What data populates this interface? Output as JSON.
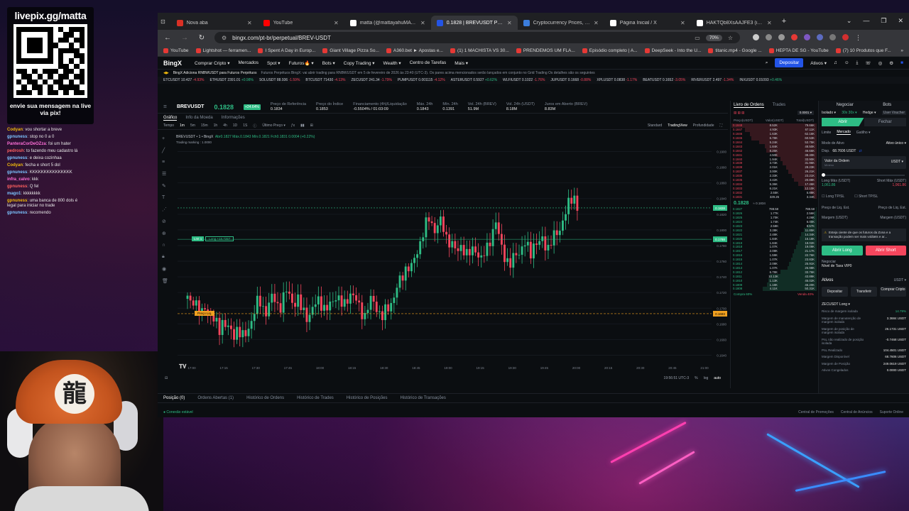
{
  "overlay": {
    "livepix_title": "livepix.gg/matta",
    "livepix_msg": "envie sua mensagem na live via pix!",
    "chat": [
      {
        "user": "Codyan",
        "msg": "vou shortar a breve"
      },
      {
        "user": "gpnuness",
        "msg": "stop no 0 a 0"
      },
      {
        "user": "PanteraCorDeOZza",
        "msg": "foi um hater"
      },
      {
        "user": "pedrosh",
        "msg": "to fazendo meu cadastro lá"
      },
      {
        "user": "gpnuness",
        "msg": "e deixa cozinhaa"
      },
      {
        "user": "Codyan",
        "msg": "fecha e short 5 dol"
      },
      {
        "user": "gpnuness",
        "msg": "KKKKKKKKKKKKKKK"
      },
      {
        "user": "infra_calvo",
        "msg": "kkk"
      },
      {
        "user": "gpnuness",
        "msg": "Q fel"
      },
      {
        "user": "mago1",
        "msg": "kkkkkkkk"
      },
      {
        "user": "gpnuness",
        "msg": "uma banca de 800 dols é legal para iniciar no trade"
      },
      {
        "user": "gpnuness",
        "msg": "recomendo"
      }
    ],
    "cap_symbol": "龍"
  },
  "browser": {
    "tabs": [
      {
        "label": "Nova aba",
        "color": "#d93025"
      },
      {
        "label": "YouTube",
        "color": "#ff0000"
      },
      {
        "label": "matta (@mattayahuMATEUS) / X",
        "color": "#ffffff"
      },
      {
        "label": "0.1828 | BREVUSDT Perpétuos ou",
        "color": "#2354e6"
      },
      {
        "label": "Cryptocurrency Prices, Charts A",
        "color": "#3b7ddd"
      },
      {
        "label": "Página Inicial / X",
        "color": "#ffffff"
      },
      {
        "label": "HAKTQb8XsAAJFE3 (imagem JPE",
        "color": "#ffffff"
      }
    ],
    "new_tab": "+",
    "win_controls": [
      "⌄",
      "—",
      "❐",
      "✕"
    ],
    "url": "bingx.com/pt-br/perpetual/BREV-USDT",
    "zoom": "70%",
    "bookmarks": [
      "YouTube",
      "Lightshot — ferramen...",
      "I Spent A Day in Europ...",
      "Giant Village Pizza So...",
      "A360.bet ► Apostas e...",
      "(1) 1 MACHISTA VS 30...",
      "PRENDEMOS UM FLA...",
      "Episódio completo | A...",
      "DeepSeek - Into the U...",
      "titanic.mp4 - Google ...",
      "HEPTA DE SG - YouTube",
      "(7) 10 Produtos que F..."
    ]
  },
  "bingx": {
    "logo": "BingX",
    "nav": [
      "Comprar Cripto ▾",
      "Mercados",
      "Spot ▾",
      "Futuros🔥 ▾",
      "Bots ▾",
      "Copy Trading ▾",
      "Wealth ▾",
      "Centro de Tarefas",
      "Mais ▾"
    ],
    "deposit": "Depositar",
    "assets": "Ativos ▾",
    "news": "BingX Adiciona RNBWUSDT para Futuros Perpétuos",
    "news_detail": "Futuros Perpétuos BingX: vai abrir trading para RNBWUSDT em 5 de fevereiro de 2026 às 23:40 (UTC-3). Os pares acima mencionados serão lançados em conjunto no Grid Trading Os detalhes são os seguintes",
    "tickers": [
      {
        "s": "ETCUSDT",
        "p": "10.427",
        "c": "-4.93%",
        "neg": true
      },
      {
        "s": "ETHUSDT",
        "p": "2391.01",
        "c": "+0.98%",
        "neg": false
      },
      {
        "s": "SOLUSDT",
        "p": "88.936",
        "c": "-1.59%",
        "neg": true
      },
      {
        "s": "BTCUSDT",
        "p": "71430",
        "c": "-4.13%",
        "neg": true
      },
      {
        "s": "ZECUSDT",
        "p": "241.34",
        "c": "-1.79%",
        "neg": true
      },
      {
        "s": "PUMPUSDT",
        "p": "0.001115",
        "c": "-4.12%",
        "neg": true
      },
      {
        "s": "ASTERUSDT",
        "p": "0.5927",
        "c": "+0.62%",
        "neg": false
      },
      {
        "s": "WLFIUSDT",
        "p": "0.1022",
        "c": "-1.76%",
        "neg": true
      },
      {
        "s": "JUPUSDT",
        "p": "0.1668",
        "c": "-0.88%",
        "neg": true
      },
      {
        "s": "XPLUSDT",
        "p": "0.0838",
        "c": "-1.17%",
        "neg": true
      },
      {
        "s": "BEATUSDT",
        "p": "0.1652",
        "c": "-3.05%",
        "neg": true
      },
      {
        "s": "RIVERUSDT",
        "p": "2.497",
        "c": "-1.34%",
        "neg": true
      },
      {
        "s": "INXUSDT",
        "p": "0.01093",
        "c": "+0.46%",
        "neg": false
      }
    ],
    "symbol": {
      "name": "BREVUSDT",
      "price": "0.1828",
      "change": "+24.64%",
      "stats": [
        {
          "k": "Preço de Referência",
          "v": "0.1834"
        },
        {
          "k": "Preço do Índice",
          "v": "0.1853"
        },
        {
          "k": "Financiamento (4h)/Liquidação",
          "v": "-0.5504% / 01:03:09"
        },
        {
          "k": "Máx. 24h",
          "v": "0.1843"
        },
        {
          "k": "Mín. 24h",
          "v": "0.1391"
        },
        {
          "k": "Vol. 24h (BREV)",
          "v": "51.9M"
        },
        {
          "k": "Vol. 24h (USDT)",
          "v": "8.18M"
        },
        {
          "k": "Juros em Aberto (BREV)",
          "v": "8.83M"
        }
      ]
    },
    "chart_tabs": [
      "Gráfico",
      "Info da Moeda",
      "Informações"
    ],
    "tv_toolbar": [
      "Tempo",
      "1m",
      "5m",
      "15m",
      "1h",
      "4h",
      "1D",
      "1S",
      "ⓘ",
      "Último Preço ▾"
    ],
    "tv_views": [
      "Standard",
      "TradingView",
      "Profundidade"
    ],
    "ohlc": {
      "label": "BREVUSDT • 1 • BingX",
      "text": "Abr0.1827 Máx.0.1843 Mín.0.1821 Fch0.1831 0.0004 (+0.22%)",
      "mark": "Trading marking : 1.0000"
    },
    "pos_label": [
      "Lmt 1",
      "Long +16.7257"
    ],
    "liq_label": "Preço Liq.",
    "footer_time": "19:56:51 UTC-3",
    "footer_r": [
      "%",
      "log",
      "auto"
    ],
    "bottom_tabs": [
      "Posição (0)",
      "Ordens Abertas (1)",
      "Histórico de Ordens",
      "Histórico de Trades",
      "Histórico de Posições",
      "Histórico de Transações"
    ],
    "status": "Conexão estável",
    "status_r": [
      "Central de Promoções",
      "Central de Anúncios",
      "Suporte Online"
    ],
    "orderbook": {
      "tabs": [
        "Livro de Ordens",
        "Trades"
      ],
      "step": "0.0001 ▾",
      "head": [
        "Preço(USDT)",
        "Valor(USDT)",
        "Total(USDT)"
      ],
      "asks": [
        [
          "0.1848",
          "8.52K",
          "79.66K"
        ],
        [
          "0.1847",
          "4.93K",
          "67.11K"
        ],
        [
          "0.1846",
          "1.63K",
          "62.16K"
        ],
        [
          "0.1845",
          "6.78K",
          "60.53K"
        ],
        [
          "0.1844",
          "5.24K",
          "53.75K"
        ],
        [
          "0.1843",
          "1.84K",
          "48.50K"
        ],
        [
          "0.1842",
          "8.26K",
          "46.66K"
        ],
        [
          "0.1841",
          "4.50K",
          "38.40K"
        ],
        [
          "0.1840",
          "1.94K",
          "33.90K"
        ],
        [
          "0.1839",
          "3.73K",
          "31.96K"
        ],
        [
          "0.1838",
          "2.01K",
          "28.23K"
        ],
        [
          "0.1837",
          "3.00K",
          "26.21K"
        ],
        [
          "0.1836",
          "2.33K",
          "23.21K"
        ],
        [
          "0.1835",
          "3.42K",
          "20.88K"
        ],
        [
          "0.1834",
          "5.36K",
          "17.46K"
        ],
        [
          "0.1833",
          "6.21K",
          "12.10K"
        ],
        [
          "0.1832",
          "2.55K",
          "5.89K"
        ],
        [
          "0.1831",
          "329.26",
          "3.34K"
        ]
      ],
      "mid_price": "0.1828",
      "mid_sub": "≈ 0.1834",
      "bids": [
        [
          "0.1827",
          "788.58",
          "788.58"
        ],
        [
          "0.1826",
          "1.77K",
          "2.56K"
        ],
        [
          "0.1825",
          "1.70K",
          "4.26K"
        ],
        [
          "0.1824",
          "1.74K",
          "6.00K"
        ],
        [
          "0.1823",
          "2.58K",
          "8.57K"
        ],
        [
          "0.1822",
          "3.28K",
          "11.85K"
        ],
        [
          "0.1821",
          "2.48K",
          "14.34K"
        ],
        [
          "0.1820",
          "1.84K",
          "16.18K"
        ],
        [
          "0.1819",
          "1.84K",
          "18.02K"
        ],
        [
          "0.1818",
          "1.07K",
          "19.09K"
        ],
        [
          "0.1817",
          "2.08K",
          "21.17K"
        ],
        [
          "0.1816",
          "1.59K",
          "22.76K"
        ],
        [
          "0.1815",
          "1.07K",
          "23.83K"
        ],
        [
          "0.1814",
          "2.08K",
          "25.91K"
        ],
        [
          "0.1813",
          "1.07K",
          "26.98K"
        ],
        [
          "0.1812",
          "6.78K",
          "33.76K"
        ],
        [
          "0.1811",
          "10.13K",
          "43.89K"
        ],
        [
          "0.1810",
          "1.13K",
          "45.02K"
        ],
        [
          "0.1809",
          "1.18K",
          "46.20K"
        ],
        [
          "0.1808",
          "4.11K",
          "50.31K"
        ]
      ],
      "ratio_buy": "Compra 60%",
      "ratio_sell": "Venda 40%"
    },
    "panel": {
      "tabs": [
        "Negociar",
        "Bots"
      ],
      "margin": "Isolado ▾",
      "leverage": "30x 30x ▾",
      "mode": "Hedge ▾",
      "user_mode": "User Voucher",
      "open": "Abrir",
      "close": "Fechar",
      "order_types": [
        "Limite",
        "Mercado",
        "Gatilho ▾"
      ],
      "asset_mode_label": "Modo de Ativo",
      "asset_mode_value": "Ativo único ▾",
      "avail_label": "Disp.",
      "avail_value": "68.7606 USDT",
      "order_value_label": "Valor da Ordem",
      "order_value_hint": "Mínimo",
      "order_value_unit": "USDT ▾",
      "long_max_label": "Long Máx (USDT)",
      "long_max_value": "1,061.86",
      "short_max_label": "Short Máx (USDT)",
      "short_max_value": "1,061.86",
      "tpsl_long": "Long TP/SL",
      "tpsl_short": "Short TP/SL",
      "liq_long_label": "Preço de Liq. Est.",
      "liq_short_label": "Preço de Liq. Est.",
      "margin_long_label": "Margem (USDT)",
      "margin_short_label": "Margem (USDT)",
      "warn": "Esteja ciente de que os futuros da Zona e a transação podem ser mais voláteis e ar...",
      "buy": "Abrir Long",
      "sell": "Abrir Short",
      "fee_label": "Negociar",
      "fee_value": "Nível de Taxa VIP0",
      "assets_title": "Ativos",
      "assets_unit": "USDT ▾",
      "asset_btns": [
        "Depositar",
        "Transferir",
        "Comprar Cripto"
      ],
      "position": "ZECUSDT Long ▾",
      "kv": [
        {
          "k": "Risco de margem isolada",
          "v": "14.79%"
        },
        {
          "k": "Margem de manutenção de margem isolada",
          "v": "3.3684 USDT"
        },
        {
          "k": "Margem de posição de margem isolada",
          "v": "26.1731 USDT"
        },
        {
          "k": "PnL não realizado de posição isolada",
          "v": "-0.7468 USDT"
        },
        {
          "k": "PnL Realizado",
          "v": "104.4501 USDT"
        },
        {
          "k": "Margem Disponível",
          "v": "68.7606 USDT"
        },
        {
          "k": "Margem de Posição",
          "v": "249.0619 USDT"
        },
        {
          "k": "Ativos Congelados",
          "v": "0.0000 USDT"
        }
      ]
    },
    "y_axis_prices": [
      "0.1900",
      "0.1880",
      "0.1860",
      "0.1840",
      "0.1820",
      "0.1800",
      "0.1780",
      "0.1760",
      "0.1740",
      "0.1720",
      "0.1700",
      "0.1680",
      "0.1660",
      "0.1640"
    ],
    "x_axis_times": [
      "17:00",
      "17:15",
      "17:30",
      "17:45",
      "18:00",
      "18:15",
      "18:30",
      "18:45",
      "19:00",
      "19:15",
      "19:30",
      "19:45",
      "20:00",
      "20:15",
      "20:30",
      "20:45",
      "21:00"
    ],
    "current_price_tag": "0.1828",
    "pos_price_tag": "0.1788",
    "liq_price_tag": "0.1693"
  },
  "chart_data": {
    "type": "candlestick",
    "ylim": [
      0.1635,
      0.1905
    ],
    "close": [
      0.1712,
      0.1705,
      0.1715,
      0.1698,
      0.169,
      0.1702,
      0.1695,
      0.1688,
      0.168,
      0.1672,
      0.1686,
      0.1678,
      0.167,
      0.1664,
      0.1675,
      0.1668,
      0.166,
      0.1672,
      0.1685,
      0.1698,
      0.171,
      0.1703,
      0.1695,
      0.1705,
      0.1715,
      0.1708,
      0.17,
      0.1712,
      0.1722,
      0.1715,
      0.1705,
      0.1712,
      0.17,
      0.1695,
      0.1688,
      0.1695,
      0.1704,
      0.1712,
      0.1705,
      0.1695,
      0.1702,
      0.171,
      0.1718,
      0.1708,
      0.17,
      0.1712,
      0.172,
      0.1714,
      0.1705,
      0.1697,
      0.169,
      0.1702,
      0.1712,
      0.1705,
      0.1695,
      0.1688,
      0.1697,
      0.1704,
      0.1712,
      0.1724,
      0.1735,
      0.1745,
      0.1756,
      0.1748,
      0.1762,
      0.1775,
      0.179,
      0.1802,
      0.1815,
      0.1808,
      0.1798,
      0.1812,
      0.1805,
      0.1792,
      0.1785,
      0.1778,
      0.177,
      0.1782,
      0.1775,
      0.1765,
      0.1772,
      0.178,
      0.1768,
      0.176,
      0.1772,
      0.1785,
      0.1795,
      0.1808,
      0.179,
      0.1775,
      0.176,
      0.1752,
      0.1765,
      0.1775,
      0.177,
      0.1782,
      0.1778,
      0.1772,
      0.1785,
      0.1778,
      0.179,
      0.1782,
      0.1776,
      0.1788,
      0.1795,
      0.1802,
      0.1812,
      0.1825,
      0.1838,
      0.1846,
      0.1828
    ],
    "title": "BREVUSDT • 1 • BingX"
  }
}
